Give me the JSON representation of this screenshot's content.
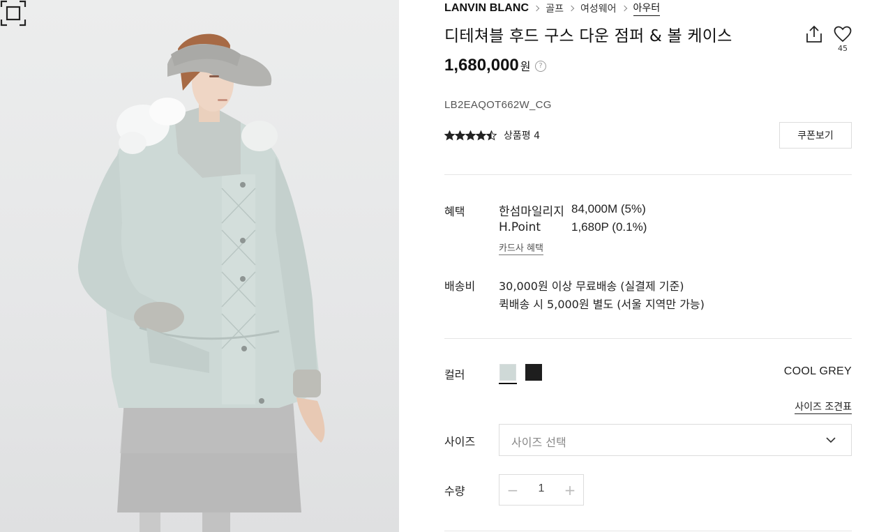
{
  "breadcrumb": {
    "brand": "LANVIN BLANC",
    "items": [
      "골프",
      "여성웨어",
      "아우터"
    ]
  },
  "product": {
    "title": "디테쳐블 후드 구스 다운 점퍼 & 볼 케이스",
    "price": "1,680,000",
    "price_unit": "원",
    "sku": "LB2EAQOT662W_CG",
    "rating": 4.5,
    "review_label": "상품평 4",
    "wish_count": "45"
  },
  "actions": {
    "coupon_label": "쿠폰보기",
    "zoom_icon": "fullscreen-icon",
    "share_icon": "share-icon",
    "wish_icon": "heart-icon",
    "help_icon": "question-icon",
    "help_glyph": "?"
  },
  "benefits": {
    "label": "혜택",
    "items": [
      {
        "name": "한섬마일리지",
        "value": "84,000M (5%)"
      },
      {
        "name": "H.Point",
        "value": "1,680P (0.1%)"
      }
    ],
    "card_link": "카드사 혜택"
  },
  "shipping": {
    "label": "배송비",
    "lines": [
      "30,000원 이상 무료배송 (실결제 기준)",
      "퀵배송 시 5,000원 별도 (서울 지역만 가능)"
    ]
  },
  "color": {
    "label": "컬러",
    "swatches": [
      {
        "name": "COOL GREY",
        "hex": "#cfd9d7",
        "selected": true
      },
      {
        "name": "BLACK",
        "hex": "#1e1e1e",
        "selected": false
      }
    ],
    "selected_name": "COOL GREY"
  },
  "size": {
    "label": "사이즈",
    "guide_link": "사이즈 조견표",
    "placeholder": "사이즈 선택"
  },
  "quantity": {
    "label": "수량",
    "value": "1",
    "minus_glyph": "−",
    "plus_glyph": "+"
  },
  "colors": {
    "text": "#111111",
    "border": "#dcdcdc",
    "divider": "#e5e5e5",
    "photo_bg": "#e6e7e8"
  }
}
